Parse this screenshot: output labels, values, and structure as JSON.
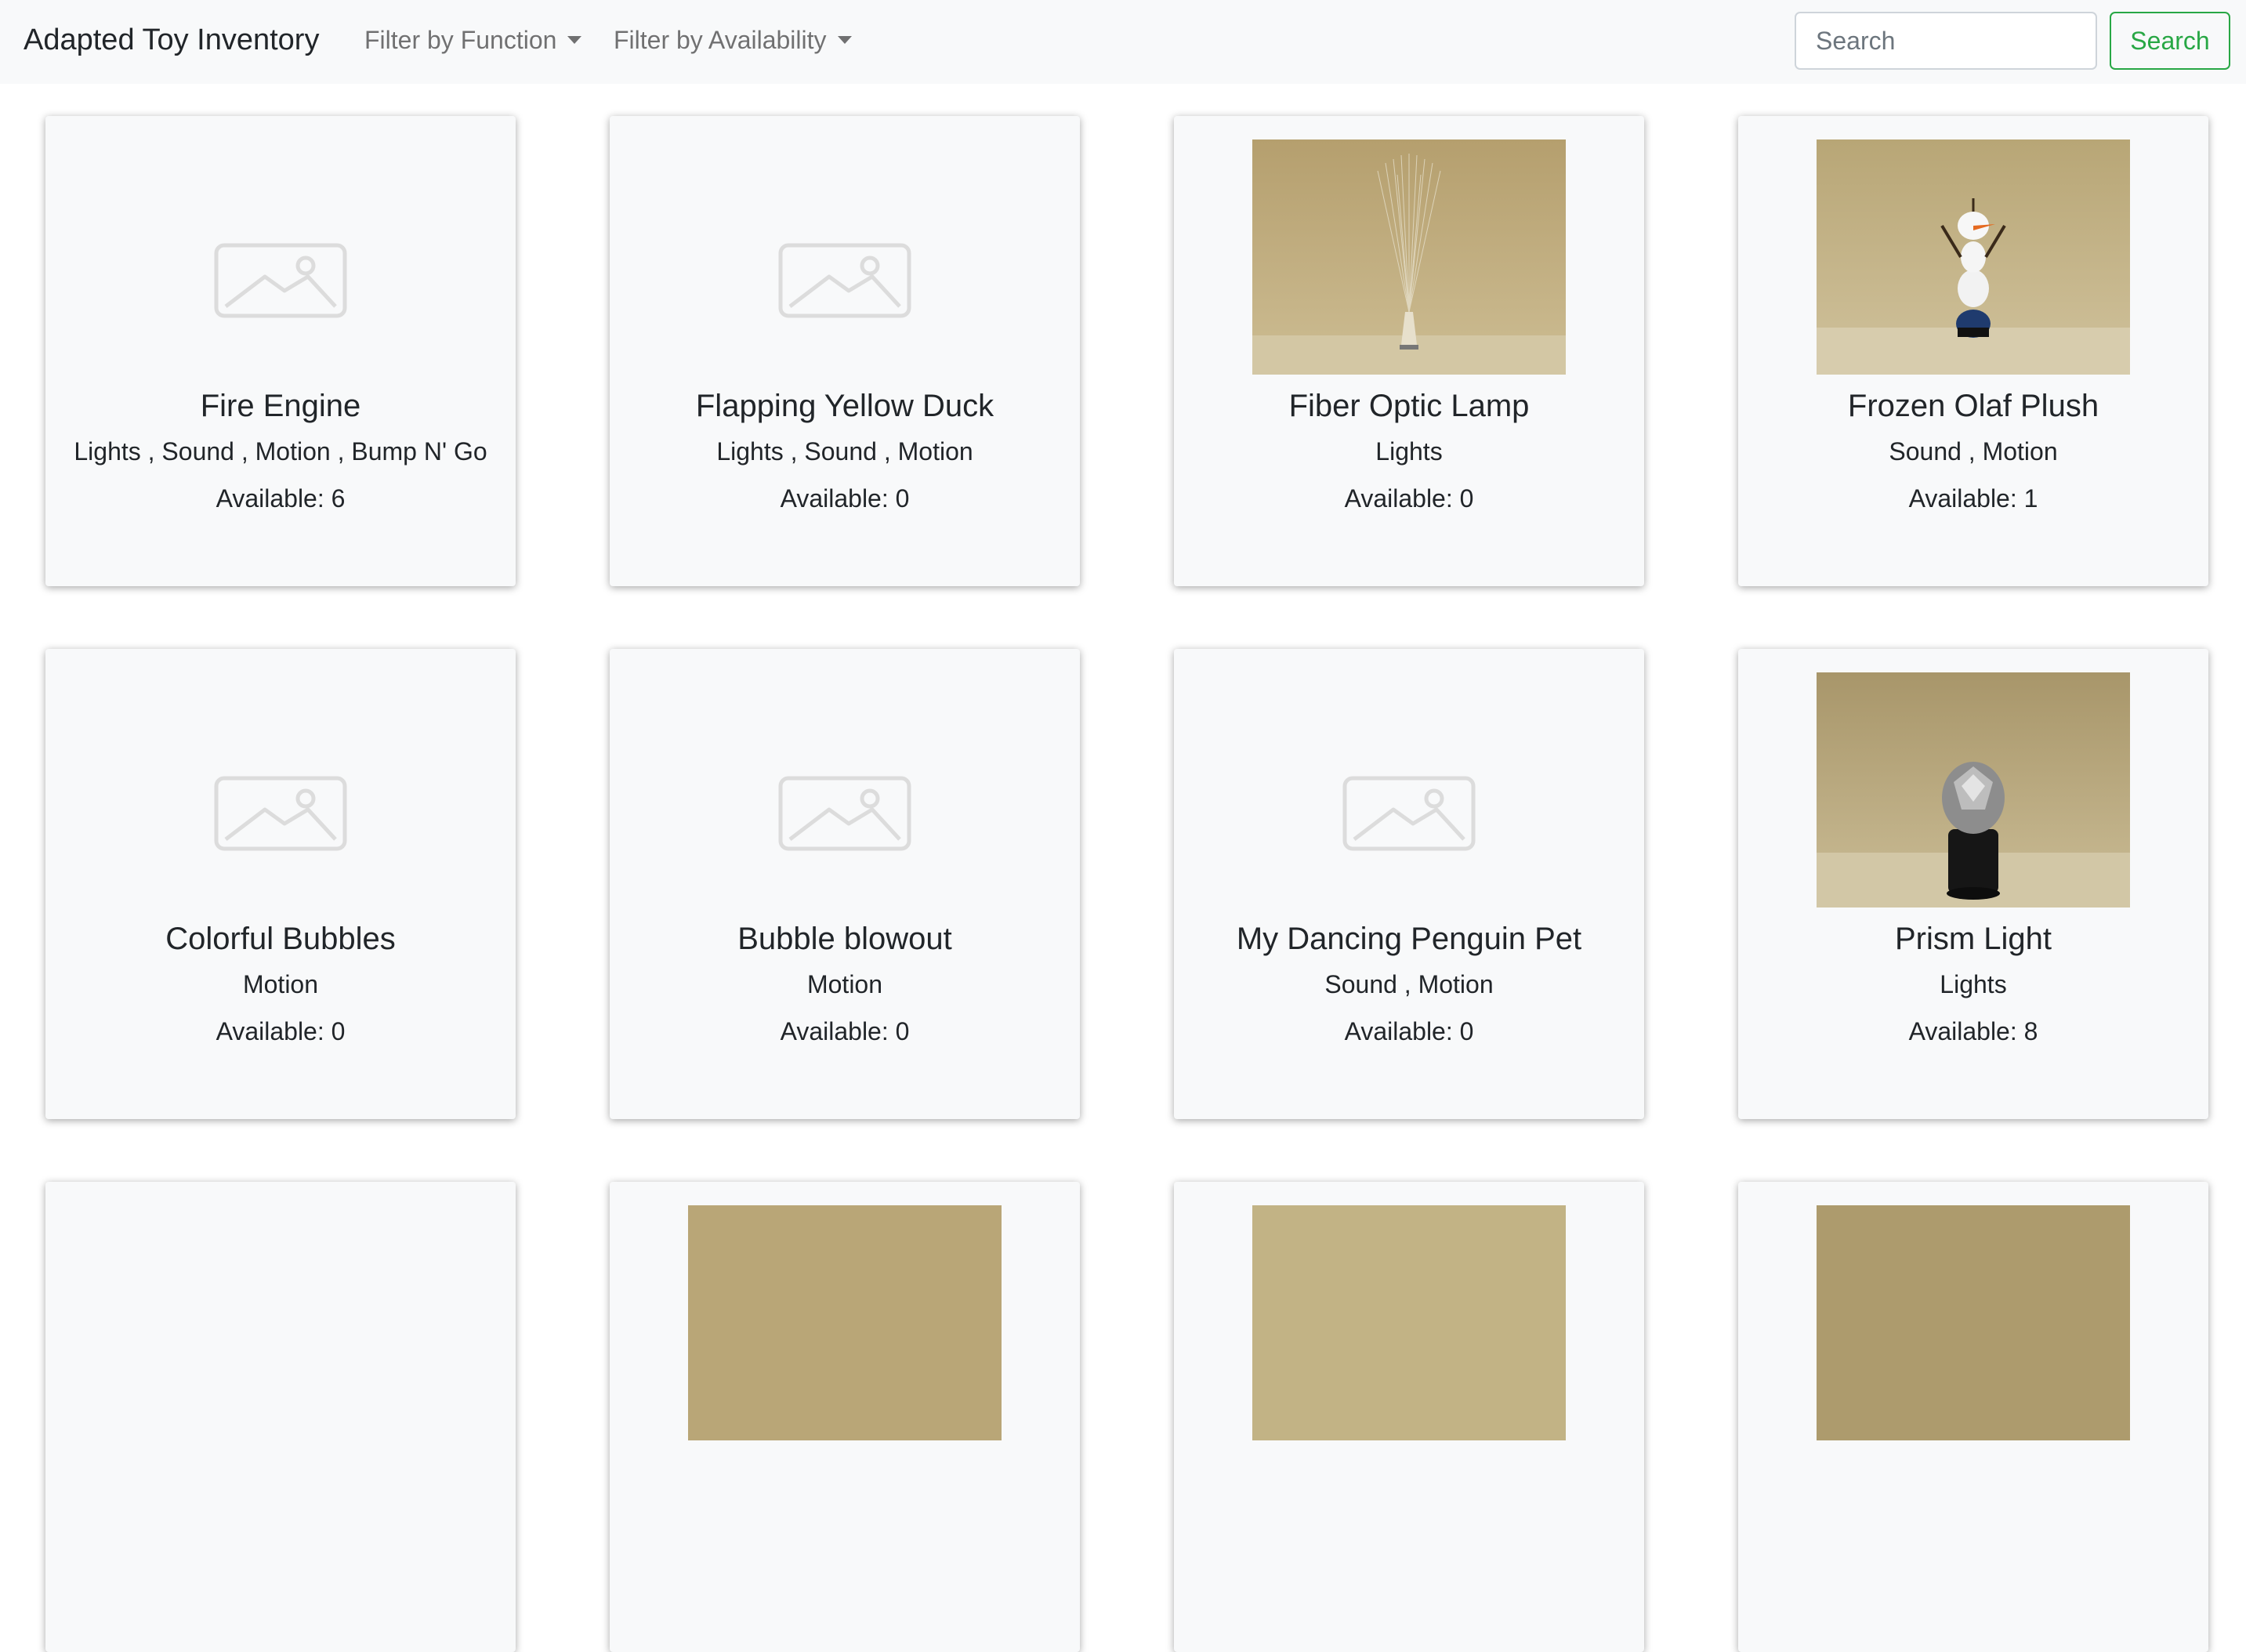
{
  "navbar": {
    "brand": "Adapted Toy Inventory",
    "filter_function_label": "Filter by Function",
    "filter_availability_label": "Filter by Availability",
    "search_placeholder": "Search",
    "search_button_label": "Search"
  },
  "toys": [
    {
      "name": "Fire Engine",
      "functions": "Lights , Sound , Motion , Bump N' Go",
      "available": "Available: 6",
      "image": "placeholder-icon"
    },
    {
      "name": "Flapping Yellow Duck",
      "functions": "Lights , Sound , Motion",
      "available": "Available: 0",
      "image": "placeholder-icon"
    },
    {
      "name": "Fiber Optic Lamp",
      "functions": "Lights",
      "available": "Available: 0",
      "image": "fiber-optic-lamp-photo"
    },
    {
      "name": "Frozen Olaf Plush",
      "functions": "Sound , Motion",
      "available": "Available: 1",
      "image": "olaf-plush-photo"
    },
    {
      "name": "Colorful Bubbles",
      "functions": "Motion",
      "available": "Available: 0",
      "image": "placeholder-icon"
    },
    {
      "name": "Bubble blowout",
      "functions": "Motion",
      "available": "Available: 0",
      "image": "placeholder-icon"
    },
    {
      "name": "My Dancing Penguin Pet",
      "functions": "Sound , Motion",
      "available": "Available: 0",
      "image": "placeholder-icon"
    },
    {
      "name": "Prism Light",
      "functions": "Lights",
      "available": "Available: 8",
      "image": "prism-light-photo"
    }
  ],
  "colors": {
    "navbar_bg": "#f8f9fa",
    "search_accent": "#28a745",
    "card_bg": "#f8f9fa",
    "photo_backdrop": "#b9a677"
  }
}
